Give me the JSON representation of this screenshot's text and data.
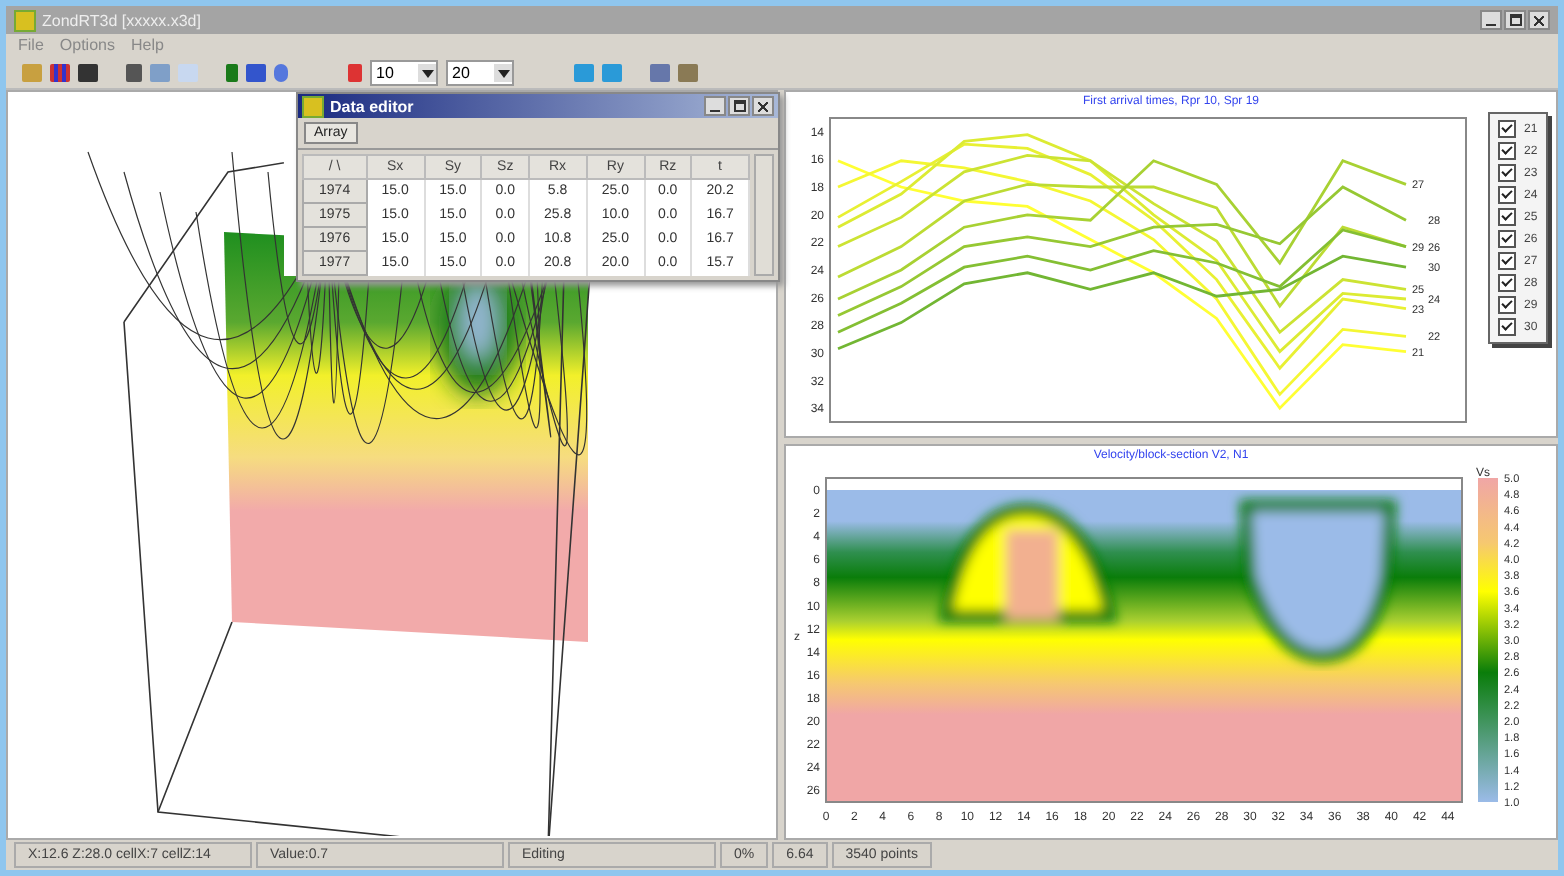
{
  "window": {
    "title": "ZondRT3d [xxxxx.x3d]"
  },
  "menu": [
    "File",
    "Options",
    "Help"
  ],
  "toolbar": {
    "combos": [
      "10",
      "20"
    ]
  },
  "data_editor": {
    "title": "Data editor",
    "tabs": [
      {
        "label": "Array",
        "selected": true
      }
    ],
    "columns": [
      "/ \\",
      "Sx",
      "Sy",
      "Sz",
      "Rx",
      "Ry",
      "Rz",
      "t"
    ],
    "rows": [
      [
        "1974",
        "15.0",
        "15.0",
        "0.0",
        "5.8",
        "25.0",
        "0.0",
        "20.2"
      ],
      [
        "1975",
        "15.0",
        "15.0",
        "0.0",
        "25.8",
        "10.0",
        "0.0",
        "16.7"
      ],
      [
        "1976",
        "15.0",
        "15.0",
        "0.0",
        "10.8",
        "25.0",
        "0.0",
        "16.7"
      ],
      [
        "1977",
        "15.0",
        "15.0",
        "0.0",
        "20.8",
        "20.0",
        "0.0",
        "15.7"
      ]
    ]
  },
  "arrival_chart": {
    "chart_data": {
      "type": "line",
      "title": "First arrival times, Rpr 10, Spr 19",
      "ylim": [
        35,
        13
      ],
      "yticks": [
        14,
        16,
        18,
        20,
        22,
        24,
        26,
        28,
        30,
        32,
        34
      ],
      "series": [
        {
          "name": "21",
          "color": "#ffff33",
          "values": [
            16.1,
            18.0,
            19.0,
            19.4,
            21.8,
            24.2,
            27.5,
            34.0,
            29.4,
            29.9
          ]
        },
        {
          "name": "22",
          "color": "#f4f733",
          "values": [
            18.0,
            16.1,
            16.6,
            17.6,
            19.0,
            21.8,
            26.1,
            33.0,
            28.3,
            28.8
          ]
        },
        {
          "name": "23",
          "color": "#e8f033",
          "values": [
            20.2,
            17.6,
            14.9,
            15.2,
            17.1,
            20.4,
            24.7,
            31.1,
            26.1,
            26.8
          ]
        },
        {
          "name": "24",
          "color": "#dceb33",
          "values": [
            20.9,
            18.5,
            14.7,
            14.2,
            16.1,
            20.0,
            23.3,
            29.9,
            25.7,
            26.1
          ]
        },
        {
          "name": "25",
          "color": "#cce333",
          "values": [
            22.3,
            20.2,
            16.9,
            15.7,
            16.1,
            19.2,
            21.9,
            28.5,
            24.7,
            25.4
          ]
        },
        {
          "name": "26",
          "color": "#bcdb33",
          "values": [
            24.5,
            22.3,
            19.0,
            17.8,
            18.0,
            18.0,
            19.5,
            26.6,
            20.9,
            22.3
          ]
        },
        {
          "name": "27",
          "color": "#a8d133",
          "values": [
            26.1,
            24.0,
            20.9,
            20.0,
            20.4,
            16.1,
            17.8,
            23.5,
            16.1,
            17.8
          ]
        },
        {
          "name": "28",
          "color": "#96c833",
          "values": [
            27.3,
            25.2,
            22.3,
            21.6,
            22.3,
            20.9,
            20.7,
            22.1,
            18.0,
            20.4
          ]
        },
        {
          "name": "29",
          "color": "#84bf33",
          "values": [
            28.5,
            26.4,
            23.8,
            23.0,
            24.0,
            22.6,
            23.5,
            25.2,
            21.1,
            22.3
          ]
        },
        {
          "name": "30",
          "color": "#72b633",
          "values": [
            29.7,
            27.8,
            25.0,
            24.2,
            25.4,
            24.2,
            25.9,
            25.4,
            23.0,
            23.8
          ]
        }
      ]
    },
    "legend": [
      {
        "label": "21",
        "checked": true
      },
      {
        "label": "22",
        "checked": true
      },
      {
        "label": "23",
        "checked": true
      },
      {
        "label": "24",
        "checked": true
      },
      {
        "label": "25",
        "checked": true
      },
      {
        "label": "26",
        "checked": true
      },
      {
        "label": "27",
        "checked": true
      },
      {
        "label": "28",
        "checked": true
      },
      {
        "label": "29",
        "checked": true
      },
      {
        "label": "30",
        "checked": true
      }
    ]
  },
  "velocity_section": {
    "title": "Velocity/block-section V2, N1",
    "ylabel": "z",
    "xticks": [
      "0",
      "2",
      "4",
      "6",
      "8",
      "10",
      "12",
      "14",
      "16",
      "18",
      "20",
      "22",
      "24",
      "26",
      "28",
      "30",
      "32",
      "34",
      "36",
      "38",
      "40",
      "42",
      "44"
    ],
    "yticks": [
      "0",
      "2",
      "4",
      "6",
      "8",
      "10",
      "12",
      "14",
      "16",
      "18",
      "20",
      "22",
      "24",
      "26"
    ],
    "colorbar": {
      "label": "Vs",
      "ticks": [
        "5.0",
        "4.8",
        "4.6",
        "4.4",
        "4.2",
        "4.0",
        "3.8",
        "3.6",
        "3.4",
        "3.2",
        "3.0",
        "2.8",
        "2.6",
        "2.4",
        "2.2",
        "2.0",
        "1.8",
        "1.6",
        "1.4",
        "1.2",
        "1.0"
      ]
    }
  },
  "status_bar": [
    "X:12.6 Z:28.0 cellX:7 cellZ:14",
    "Value:0.7",
    "Editing",
    "0%",
    "6.64",
    "3540 points"
  ]
}
